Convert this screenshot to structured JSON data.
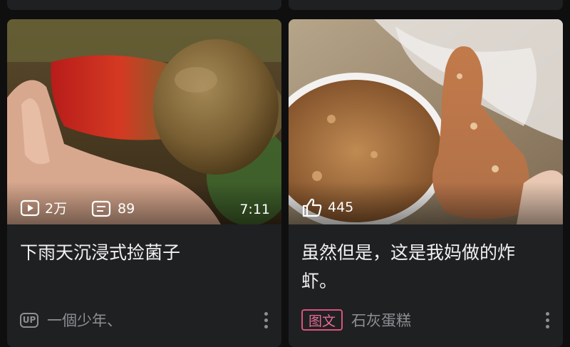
{
  "cards": [
    {
      "title": "下雨天沉浸式捡菌子",
      "play_count": "2万",
      "danmaku_count": "89",
      "duration": "7:11",
      "badge": "UP",
      "author": "一個少年、",
      "image_description_icon": "video-thumbnail"
    },
    {
      "title": "虽然但是，这是我妈做的炸虾。",
      "like_count": "445",
      "badge": "图文",
      "author": "石灰蛋糕",
      "image_description_icon": "article-thumbnail"
    }
  ],
  "colors": {
    "background": "#0f0f10",
    "card": "#1f2022",
    "title": "#f1f1f1",
    "meta": "#8e8f93",
    "tag_accent": "#e86b93"
  }
}
